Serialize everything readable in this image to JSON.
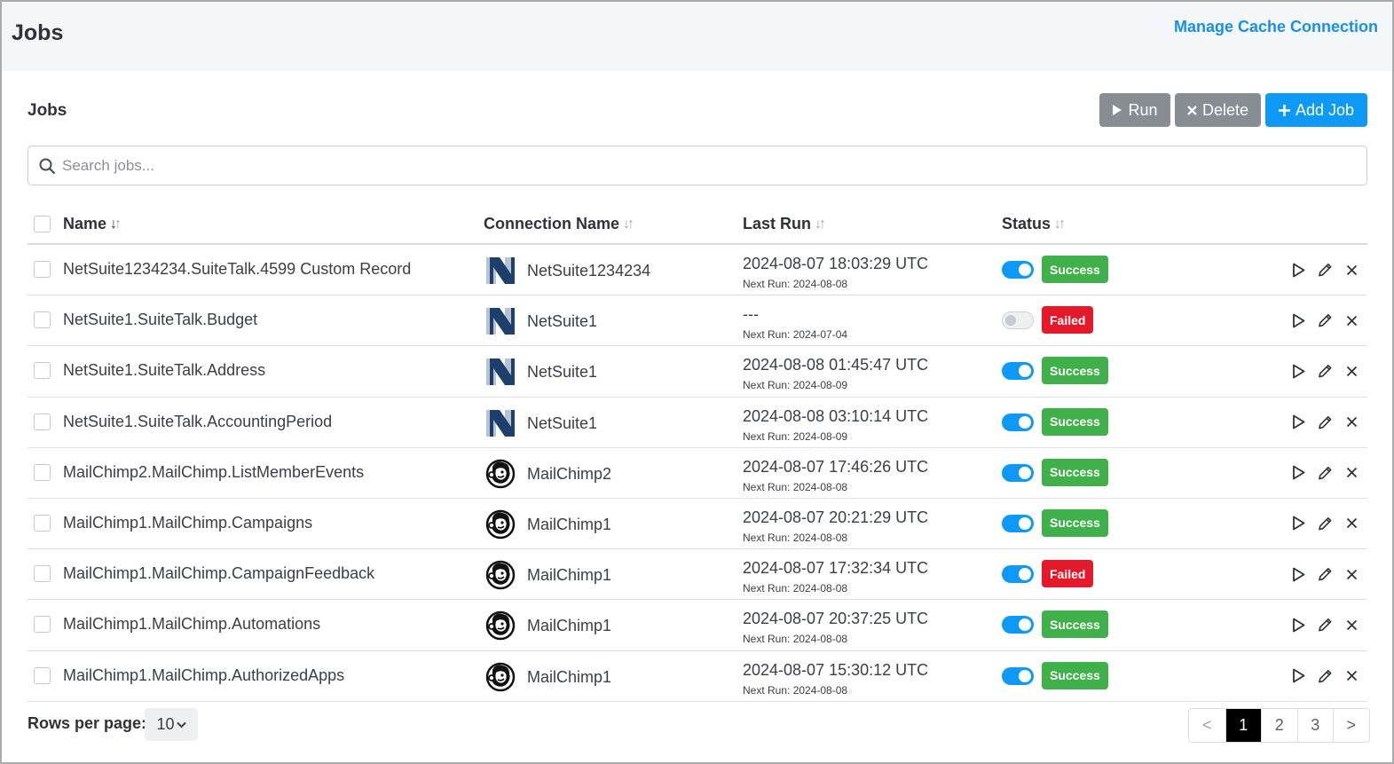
{
  "header": {
    "title": "Jobs",
    "manage_link": "Manage Cache Connection"
  },
  "section": {
    "title": "Jobs",
    "run_label": "Run",
    "delete_label": "Delete",
    "add_label": "Add Job"
  },
  "search": {
    "placeholder": "Search jobs...",
    "value": ""
  },
  "table": {
    "columns": [
      "Name",
      "Connection Name",
      "Last Run",
      "Status"
    ],
    "rows": [
      {
        "name": "NetSuite1234234.SuiteTalk.4599 Custom Record",
        "connection": "NetSuite1234234",
        "connection_icon": "netsuite-icon",
        "last_run": "2024-08-07 18:03:29 UTC",
        "next_run": "Next Run: 2024-08-08",
        "enabled": true,
        "status": "Success"
      },
      {
        "name": "NetSuite1.SuiteTalk.Budget",
        "connection": "NetSuite1",
        "connection_icon": "netsuite-icon",
        "last_run": "---",
        "next_run": "Next Run: 2024-07-04",
        "enabled": false,
        "status": "Failed"
      },
      {
        "name": "NetSuite1.SuiteTalk.Address",
        "connection": "NetSuite1",
        "connection_icon": "netsuite-icon",
        "last_run": "2024-08-08 01:45:47 UTC",
        "next_run": "Next Run: 2024-08-09",
        "enabled": true,
        "status": "Success"
      },
      {
        "name": "NetSuite1.SuiteTalk.AccountingPeriod",
        "connection": "NetSuite1",
        "connection_icon": "netsuite-icon",
        "last_run": "2024-08-08 03:10:14 UTC",
        "next_run": "Next Run: 2024-08-09",
        "enabled": true,
        "status": "Success"
      },
      {
        "name": "MailChimp2.MailChimp.ListMemberEvents",
        "connection": "MailChimp2",
        "connection_icon": "mailchimp-icon",
        "last_run": "2024-08-07 17:46:26 UTC",
        "next_run": "Next Run: 2024-08-08",
        "enabled": true,
        "status": "Success"
      },
      {
        "name": "MailChimp1.MailChimp.Campaigns",
        "connection": "MailChimp1",
        "connection_icon": "mailchimp-icon",
        "last_run": "2024-08-07 20:21:29 UTC",
        "next_run": "Next Run: 2024-08-08",
        "enabled": true,
        "status": "Success"
      },
      {
        "name": "MailChimp1.MailChimp.CampaignFeedback",
        "connection": "MailChimp1",
        "connection_icon": "mailchimp-icon",
        "last_run": "2024-08-07 17:32:34 UTC",
        "next_run": "Next Run: 2024-08-08",
        "enabled": true,
        "status": "Failed"
      },
      {
        "name": "MailChimp1.MailChimp.Automations",
        "connection": "MailChimp1",
        "connection_icon": "mailchimp-icon",
        "last_run": "2024-08-07 20:37:25 UTC",
        "next_run": "Next Run: 2024-08-08",
        "enabled": true,
        "status": "Success"
      },
      {
        "name": "MailChimp1.MailChimp.AuthorizedApps",
        "connection": "MailChimp1",
        "connection_icon": "mailchimp-icon",
        "last_run": "2024-08-07 15:30:12 UTC",
        "next_run": "Next Run: 2024-08-08",
        "enabled": true,
        "status": "Success"
      }
    ]
  },
  "footer": {
    "rows_per_page_label": "Rows per page:",
    "rows_per_page_value": "10",
    "pages": [
      "<",
      "1",
      "2",
      "3",
      ">"
    ],
    "current_page": "1"
  },
  "colors": {
    "accent": "#0d99f5",
    "success": "#40b04a",
    "failed": "#e6192b",
    "secondary_button": "#878d93"
  }
}
